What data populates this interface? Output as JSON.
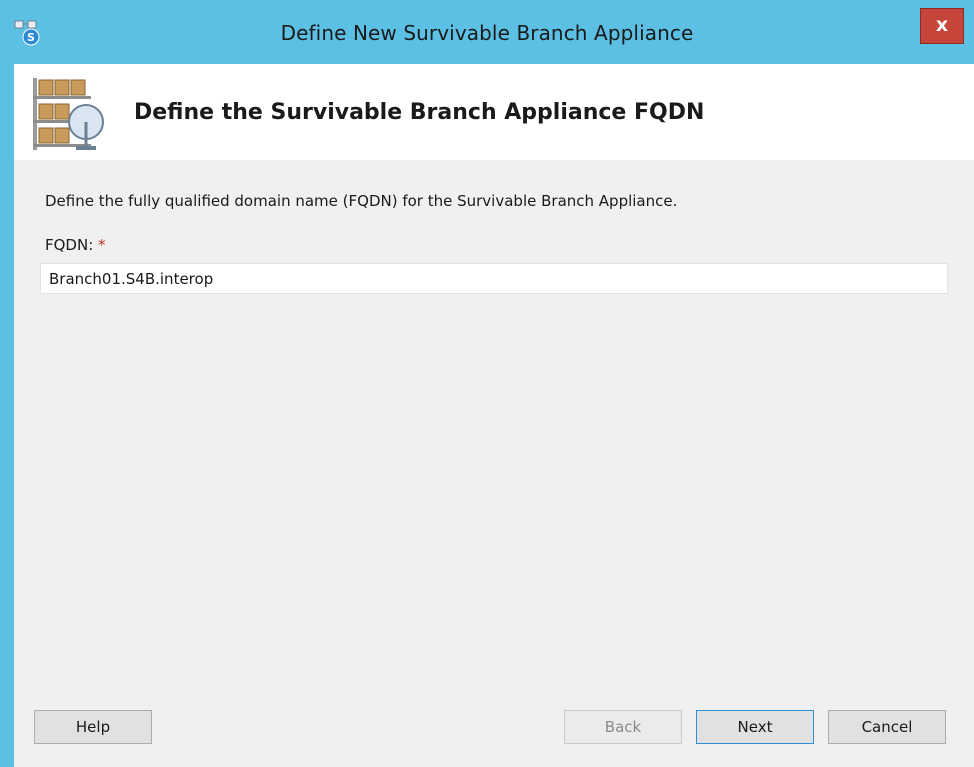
{
  "window": {
    "title": "Define New Survivable Branch Appliance",
    "close_label": "x"
  },
  "header": {
    "title": "Define the Survivable Branch Appliance FQDN"
  },
  "main": {
    "description": "Define the fully qualified domain name (FQDN) for the Survivable Branch Appliance.",
    "fqdn_label": "FQDN:",
    "required_marker": "*",
    "fqdn_value": "Branch01.S4B.interop"
  },
  "footer": {
    "help_label": "Help",
    "back_label": "Back",
    "next_label": "Next",
    "cancel_label": "Cancel"
  },
  "icons": {
    "app": "skype-topology-builder-icon",
    "header": "branch-appliance-icon",
    "close": "close-icon"
  },
  "colors": {
    "titlebar": "#5bc0e3",
    "close_button": "#c5453a",
    "required": "#c0392b",
    "default_button_border": "#2e8fd6"
  }
}
